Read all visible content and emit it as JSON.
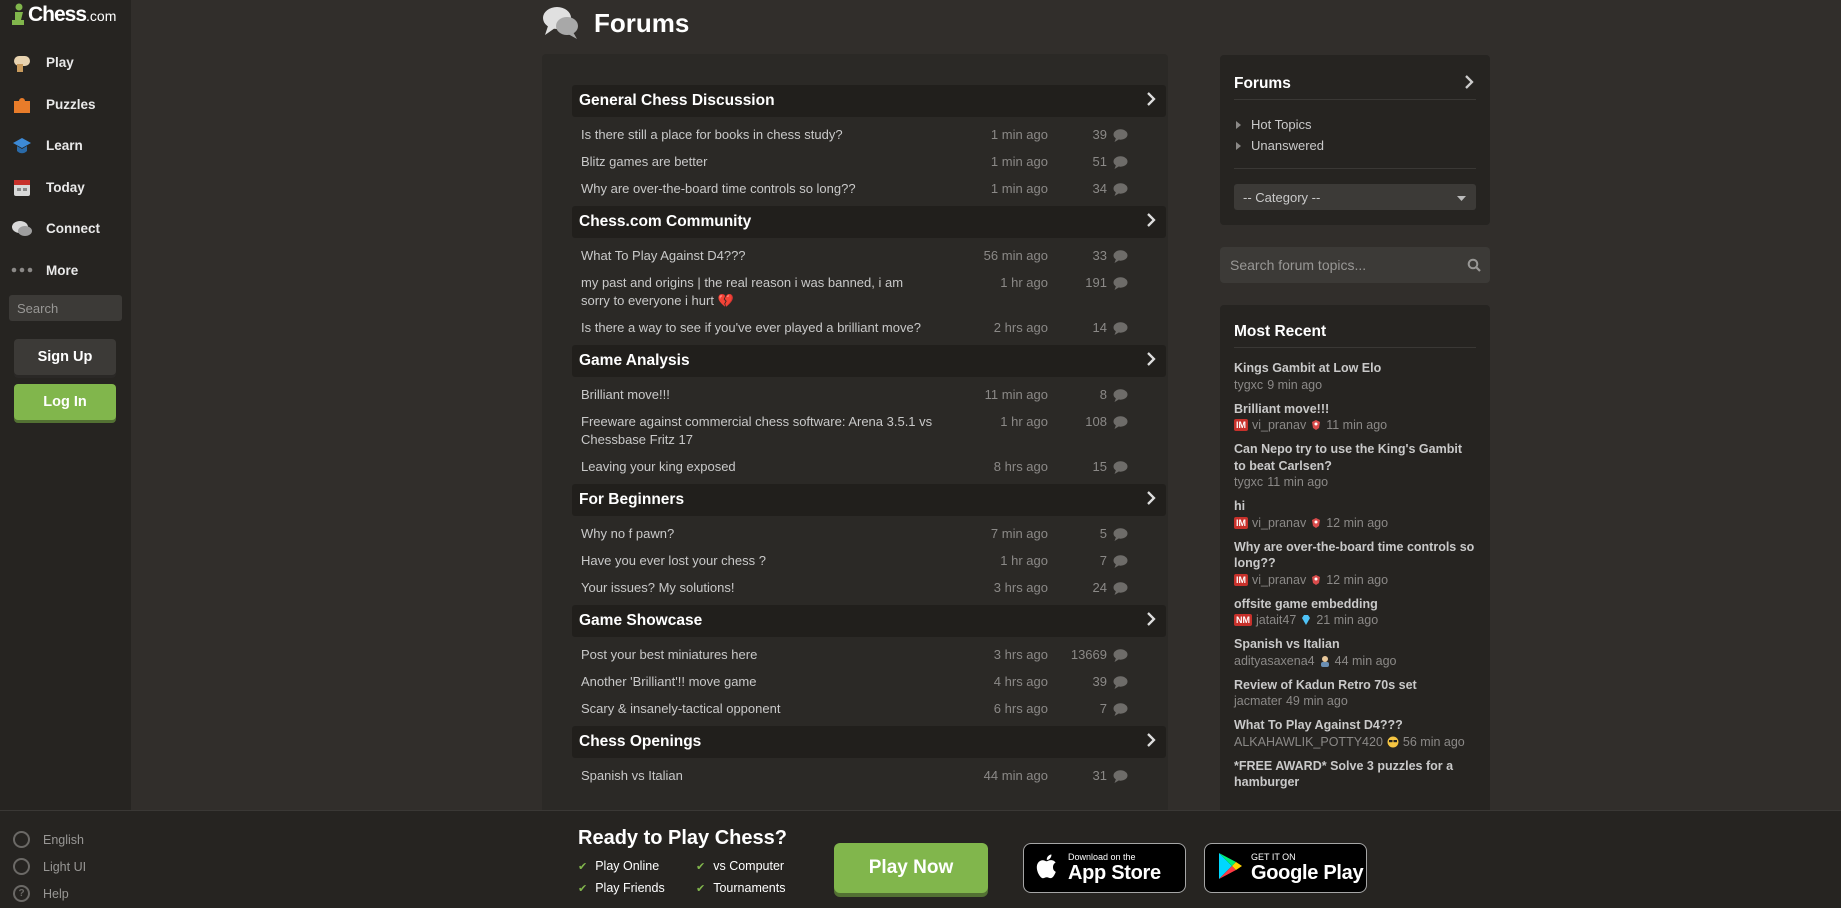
{
  "sidebar": {
    "logo": {
      "text": "Chess",
      "suffix": ".com"
    },
    "nav": [
      {
        "label": "Play",
        "icon": "play-icon"
      },
      {
        "label": "Puzzles",
        "icon": "puzzle-icon"
      },
      {
        "label": "Learn",
        "icon": "learn-icon"
      },
      {
        "label": "Today",
        "icon": "today-icon"
      },
      {
        "label": "Connect",
        "icon": "connect-icon"
      },
      {
        "label": "More",
        "icon": "more-icon"
      }
    ],
    "search_placeholder": "Search",
    "signup_label": "Sign Up",
    "login_label": "Log In",
    "footer": [
      {
        "label": "English",
        "icon": "globe-icon"
      },
      {
        "label": "Light UI",
        "icon": "light-ui-icon"
      },
      {
        "label": "Help",
        "icon": "help-icon"
      }
    ]
  },
  "header": {
    "title": "Forums"
  },
  "categories": [
    {
      "title": "General Chess Discussion",
      "topics": [
        {
          "title": "Is there still a place for books in chess study?",
          "time": "1 min ago",
          "replies": "39"
        },
        {
          "title": "Blitz games are better",
          "time": "1 min ago",
          "replies": "51"
        },
        {
          "title": "Why are over-the-board time controls so long??",
          "time": "1 min ago",
          "replies": "34"
        }
      ]
    },
    {
      "title": "Chess.com Community",
      "topics": [
        {
          "title": "What To Play Against D4???",
          "time": "56 min ago",
          "replies": "33"
        },
        {
          "title": "my past and origins | the real reason i was banned, i am sorry to everyone i hurt 💔",
          "time": "1 hr ago",
          "replies": "191"
        },
        {
          "title": "Is there a way to see if you've ever played a brilliant move?",
          "time": "2 hrs ago",
          "replies": "14"
        }
      ]
    },
    {
      "title": "Game Analysis",
      "topics": [
        {
          "title": "Brilliant move!!!",
          "time": "11 min ago",
          "replies": "8"
        },
        {
          "title": "Freeware against commercial chess software: Arena 3.5.1 vs Chessbase Fritz 17",
          "time": "1 hr ago",
          "replies": "108"
        },
        {
          "title": "Leaving your king exposed",
          "time": "8 hrs ago",
          "replies": "15"
        }
      ]
    },
    {
      "title": "For Beginners",
      "topics": [
        {
          "title": "Why no f pawn?",
          "time": "7 min ago",
          "replies": "5"
        },
        {
          "title": "Have you ever lost your chess ?",
          "time": "1 hr ago",
          "replies": "7"
        },
        {
          "title": "Your issues? My solutions!",
          "time": "3 hrs ago",
          "replies": "24"
        }
      ]
    },
    {
      "title": "Game Showcase",
      "topics": [
        {
          "title": "Post your best miniatures here",
          "time": "3 hrs ago",
          "replies": "13669"
        },
        {
          "title": "Another 'Brilliant'!! move game",
          "time": "4 hrs ago",
          "replies": "39"
        },
        {
          "title": "Scary & insanely-tactical opponent",
          "time": "6 hrs ago",
          "replies": "7"
        }
      ]
    },
    {
      "title": "Chess Openings",
      "topics": [
        {
          "title": "Spanish vs Italian",
          "time": "44 min ago",
          "replies": "31"
        }
      ]
    }
  ],
  "right": {
    "forums_title": "Forums",
    "links": [
      "Hot Topics",
      "Unanswered"
    ],
    "category_select": "-- Category --",
    "search_placeholder": "Search forum topics...",
    "recent_title": "Most Recent",
    "recent": [
      {
        "title": "Kings Gambit at Low Elo",
        "badge": "",
        "user": "tygxc",
        "flair": "",
        "time": "9 min ago"
      },
      {
        "title": "Brilliant move!!!",
        "badge": "IM",
        "user": "vi_pranav",
        "flair": "dragon",
        "time": "11 min ago"
      },
      {
        "title": "Can Nepo try to use the King's Gambit to beat Carlsen?",
        "badge": "",
        "user": "tygxc",
        "flair": "",
        "time": "11 min ago"
      },
      {
        "title": "hi",
        "badge": "IM",
        "user": "vi_pranav",
        "flair": "dragon",
        "time": "12 min ago"
      },
      {
        "title": "Why are over-the-board time controls so long??",
        "badge": "IM",
        "user": "vi_pranav",
        "flair": "dragon",
        "time": "12 min ago"
      },
      {
        "title": "offsite game embedding",
        "badge": "NM",
        "user": "jatait47",
        "flair": "diamond",
        "time": "21 min ago"
      },
      {
        "title": "Spanish vs Italian",
        "badge": "",
        "user": "adityasaxena4",
        "flair": "person",
        "time": "44 min ago"
      },
      {
        "title": "Review of Kadun Retro 70s set",
        "badge": "",
        "user": "jacmater",
        "flair": "",
        "time": "49 min ago"
      },
      {
        "title": "What To Play Against D4???",
        "badge": "",
        "user": "ALKAHAWLIK_POTTY420",
        "flair": "sunglasses",
        "time": "56 min ago"
      },
      {
        "title": "*FREE AWARD* Solve 3 puzzles for a hamburger",
        "badge": "",
        "user": "",
        "flair": "",
        "time": ""
      }
    ]
  },
  "banner": {
    "title": "Ready to Play Chess?",
    "bullets": [
      "Play Online",
      "vs Computer",
      "Play Friends",
      "Tournaments"
    ],
    "play_now": "Play Now",
    "appstore_small": "Download on the",
    "appstore_big": "App Store",
    "google_small": "GET IT ON",
    "google_big": "Google Play"
  },
  "colors": {
    "accent": "#81b64c",
    "background": "#312e2b",
    "sidebar": "#262421",
    "badge": "#c7312b"
  }
}
